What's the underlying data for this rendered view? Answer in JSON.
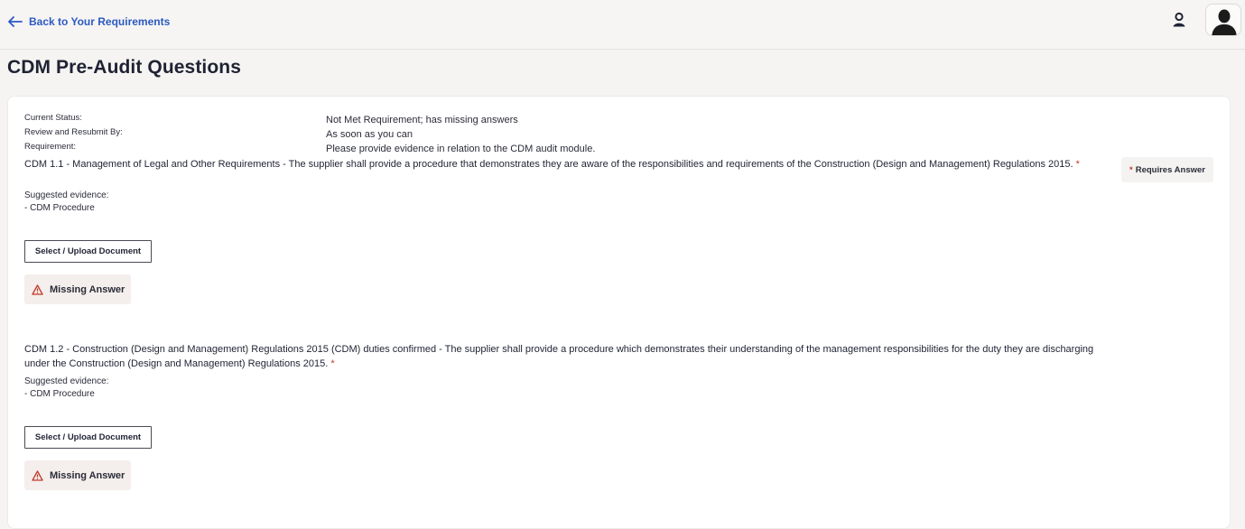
{
  "header": {
    "back_label": "Back to Your Requirements"
  },
  "page": {
    "title": "CDM Pre-Audit Questions"
  },
  "status": {
    "current_status_label": "Current Status:",
    "current_status_value": "Not Met Requirement; has missing answers",
    "review_label": "Review and Resubmit By:",
    "review_value": "As soon as you can",
    "requirement_label": "Requirement:",
    "requirement_value": "Please provide evidence in relation to the CDM audit module."
  },
  "badge": {
    "star": "*",
    "label": "Requires Answer"
  },
  "questions": [
    {
      "text": "CDM 1.1 - Management of Legal and Other Requirements - The supplier shall provide a procedure that demonstrates they are aware of the responsibilities and requirements of the Construction (Design and Management) Regulations 2015.",
      "required_marker": "*",
      "evidence_label": "Suggested evidence:",
      "evidence_item": "- CDM Procedure",
      "upload_label": "Select / Upload Document",
      "missing_label": "Missing Answer"
    },
    {
      "text": "CDM 1.2 - Construction (Design and Management) Regulations 2015 (CDM) duties confirmed - The supplier shall provide a procedure which demonstrates their understanding of the management responsibilities for the duty they are discharging under the Construction (Design and Management) Regulations 2015.",
      "required_marker": "*",
      "evidence_label": "Suggested evidence:",
      "evidence_item": "- CDM Procedure",
      "upload_label": "Select / Upload Document",
      "missing_label": "Missing Answer"
    }
  ],
  "colors": {
    "link": "#2b59c3",
    "required": "#c0392b",
    "warning_icon": "#c0392b",
    "missing_bg": "#f4eeec"
  },
  "icons": {
    "back": "arrow-left-icon",
    "user": "user-icon",
    "avatar": "avatar-silhouette",
    "warning": "warning-triangle-icon"
  }
}
